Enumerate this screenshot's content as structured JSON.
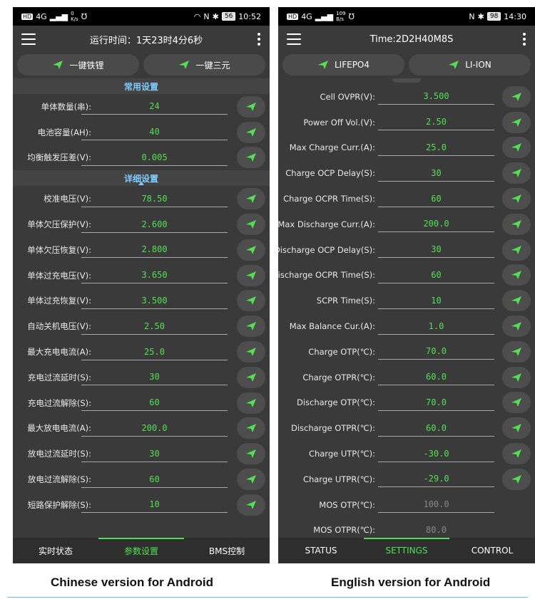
{
  "cn": {
    "status": {
      "left_badge": "HD",
      "net": "4G",
      "speed_top": "0",
      "speed_bottom": "K/s",
      "battery": "56",
      "time": "10:52"
    },
    "title": "运行时间：1天23时4分6秒",
    "presets": [
      "一键铁锂",
      "一键三元"
    ],
    "section_common": "常用设置",
    "common": [
      {
        "label": "单体数量(串):",
        "value": "24"
      },
      {
        "label": "电池容量(AH):",
        "value": "40"
      },
      {
        "label": "均衡触发压差(V):",
        "value": "0.005"
      }
    ],
    "section_detail": "详细设置",
    "detail": [
      {
        "label": "校准电压(V):",
        "value": "78.50"
      },
      {
        "label": "单体欠压保护(V):",
        "value": "2.600"
      },
      {
        "label": "单体欠压恢复(V):",
        "value": "2.800"
      },
      {
        "label": "单体过充电压(V):",
        "value": "3.650"
      },
      {
        "label": "单体过充恢复(V):",
        "value": "3.500"
      },
      {
        "label": "自动关机电压(V):",
        "value": "2.50"
      },
      {
        "label": "最大充电电流(A):",
        "value": "25.0"
      },
      {
        "label": "充电过流延时(S):",
        "value": "30"
      },
      {
        "label": "充电过流解除(S):",
        "value": "60"
      },
      {
        "label": "最大放电电流(A):",
        "value": "200.0"
      },
      {
        "label": "放电过流延时(S):",
        "value": "30"
      },
      {
        "label": "放电过流解除(S):",
        "value": "60"
      },
      {
        "label": "短路保护解除(S):",
        "value": "10"
      }
    ],
    "tabs": [
      "实时状态",
      "参数设置",
      "BMS控制"
    ],
    "caption": "Chinese version for Android"
  },
  "en": {
    "status": {
      "left_badge": "HD",
      "net": "4G",
      "speed_top": "109",
      "speed_bottom": "B/s",
      "battery": "98",
      "time": "14:30"
    },
    "title": "Time:2D2H40M8S",
    "presets": [
      "LIFEPO4",
      "LI-ION"
    ],
    "rows": [
      {
        "label": "Cell OVPR(V):",
        "value": "3.500",
        "dim": false
      },
      {
        "label": "Power Off Vol.(V):",
        "value": "2.50",
        "dim": false
      },
      {
        "label": "Max Charge Curr.(A):",
        "value": "25.0",
        "dim": false
      },
      {
        "label": "Charge OCP Delay(S):",
        "value": "30",
        "dim": false
      },
      {
        "label": "Charge OCPR Time(S):",
        "value": "60",
        "dim": false
      },
      {
        "label": "Max Discharge Curr.(A):",
        "value": "200.0",
        "dim": false
      },
      {
        "label": "Discharge OCP Delay(S):",
        "value": "30",
        "dim": false
      },
      {
        "label": "Discharge OCPR Time(S):",
        "value": "60",
        "dim": false
      },
      {
        "label": "SCPR Time(S):",
        "value": "10",
        "dim": false
      },
      {
        "label": "Max Balance Cur.(A):",
        "value": "1.0",
        "dim": false
      },
      {
        "label": "Charge OTP(℃):",
        "value": "70.0",
        "dim": false
      },
      {
        "label": "Charge OTPR(℃):",
        "value": "60.0",
        "dim": false
      },
      {
        "label": "Discharge OTP(℃):",
        "value": "70.0",
        "dim": false
      },
      {
        "label": "Discharge OTPR(℃):",
        "value": "60.0",
        "dim": false
      },
      {
        "label": "Charge UTP(℃):",
        "value": "-30.0",
        "dim": false
      },
      {
        "label": "Charge UTPR(℃):",
        "value": "-29.0",
        "dim": false
      },
      {
        "label": "MOS OTP(℃):",
        "value": "100.0",
        "dim": true
      },
      {
        "label": "MOS OTPR(℃):",
        "value": "80.0",
        "dim": true
      }
    ],
    "tabs": [
      "STATUS",
      "SETTINGS",
      "CONTROL"
    ],
    "caption": "English version for Android"
  },
  "colors": {
    "accent": "#52e052",
    "section": "#7ecbff",
    "background": "#3a3a3a"
  }
}
